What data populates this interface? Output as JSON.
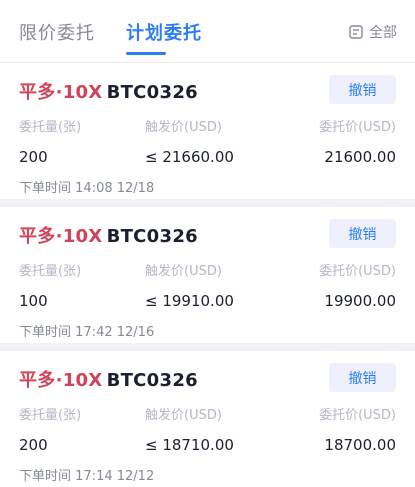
{
  "tabs": {
    "limit": "限价委托",
    "plan": "计划委托",
    "filter": "全部"
  },
  "columns": {
    "qty": "委托量(张)",
    "trigger": "触发价(USD)",
    "price": "委托价(USD)"
  },
  "cancel_label": "撤销",
  "time_label": "下单时间",
  "colors": {
    "accent": "#2e7cf6",
    "side": "#d1435a"
  },
  "orders": [
    {
      "side": "平多·10X",
      "symbol": "BTC0326",
      "qty": "200",
      "trigger": "≤ 21660.00",
      "price": "21600.00",
      "time": "14:08 12/18"
    },
    {
      "side": "平多·10X",
      "symbol": "BTC0326",
      "qty": "100",
      "trigger": "≤ 19910.00",
      "price": "19900.00",
      "time": "17:42 12/16"
    },
    {
      "side": "平多·10X",
      "symbol": "BTC0326",
      "qty": "200",
      "trigger": "≤ 18710.00",
      "price": "18700.00",
      "time": "17:14 12/12"
    }
  ]
}
